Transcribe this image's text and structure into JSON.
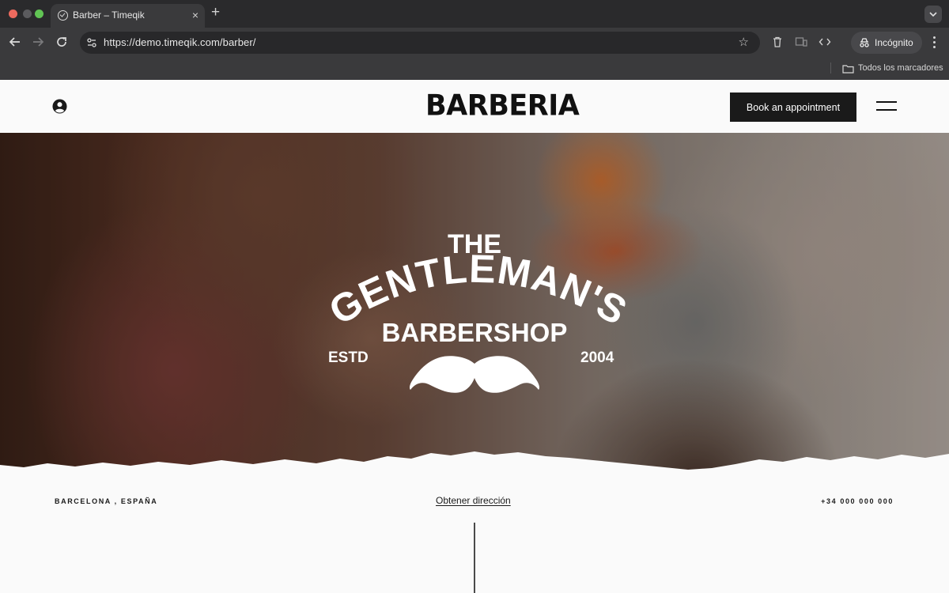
{
  "browser": {
    "tab_title": "Barber – Timeqik",
    "tab_close": "×",
    "new_tab": "+",
    "url": "https://demo.timeqik.com/barber/",
    "incognito_label": "Incógnito",
    "bookmarks_label": "Todos los marcadores",
    "icons": [
      "back-icon",
      "forward-icon",
      "reload-icon",
      "site-info-icon",
      "star-icon",
      "trash-icon",
      "device-icon",
      "code-icon",
      "incognito-icon",
      "kebab-menu-icon",
      "folder-icon"
    ]
  },
  "header": {
    "logo": "BARBERIA",
    "book_button": "Book an appointment",
    "icons": [
      "user-account-icon",
      "hamburger-menu-icon"
    ]
  },
  "hero": {
    "emblem": {
      "line1": "THE",
      "line2": "GENTLEMAN'S",
      "line3": "BARBERSHOP",
      "estd_label": "ESTD",
      "year": "2004",
      "graphic": "mustache-icon"
    }
  },
  "info": {
    "location": "BARCELONA , ESPAÑA",
    "directions_link": "Obtener dirección",
    "phone": "+34 000 000 000"
  },
  "colors": {
    "chrome_bg": "#3a3a3c",
    "page_bg": "#fafafa",
    "button_bg": "#1a1a1a",
    "text": "#111111"
  }
}
